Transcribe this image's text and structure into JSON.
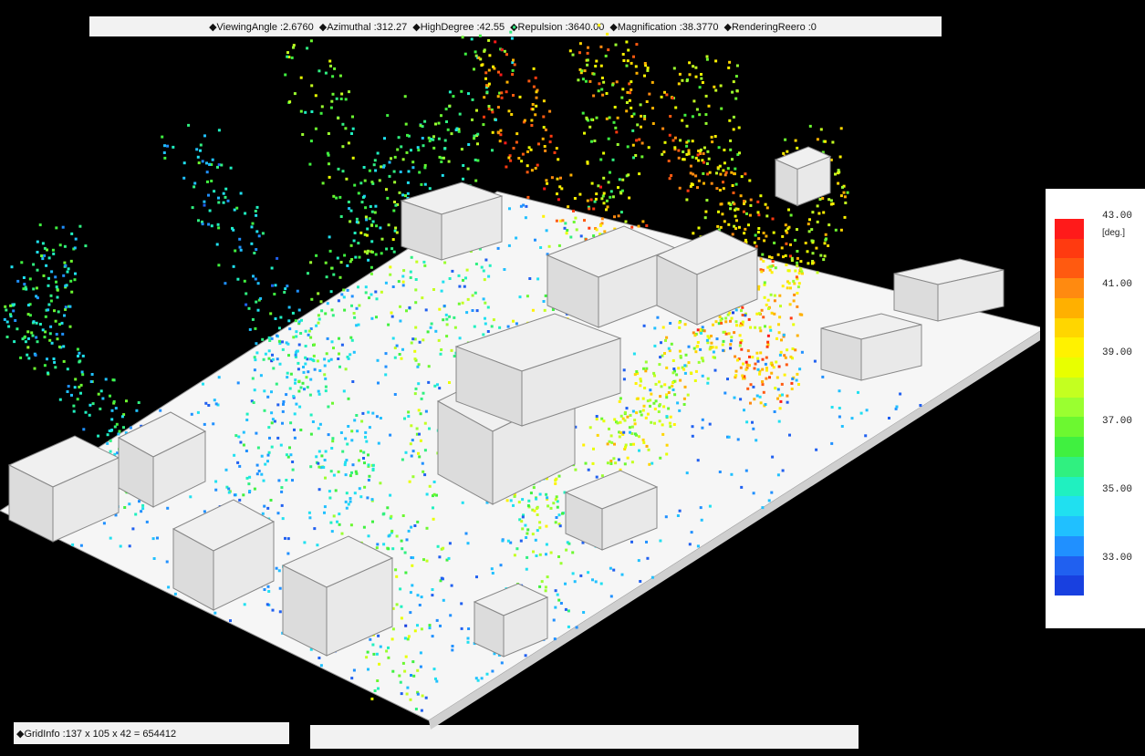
{
  "header": {
    "params": [
      {
        "label": "◆ViewingAngle",
        "value": "2.6760"
      },
      {
        "label": "◆Azimuthal",
        "value": "312.27"
      },
      {
        "label": "◆HighDegree",
        "value": "42.55"
      },
      {
        "label": "◆Repulsion",
        "value": "3640.00"
      },
      {
        "label": "◆Magnification",
        "value": "38.3770"
      },
      {
        "label": "◆RenderingReero",
        "value": "0"
      }
    ]
  },
  "footer": {
    "grid_info": "◆GridInfo :137 x 105 x 42 = 654412",
    "status_text": ""
  },
  "legend": {
    "unit": "[deg.]",
    "ticks": [
      "43.00",
      "41.00",
      "39.00",
      "37.00",
      "35.00",
      "33.00"
    ],
    "colors": [
      "#ff1a1a",
      "#ff3a10",
      "#ff5a10",
      "#ff8a10",
      "#ffb000",
      "#ffd600",
      "#fff200",
      "#e8ff00",
      "#c4ff20",
      "#9aff30",
      "#6cf830",
      "#40f040",
      "#30f080",
      "#20f0c0",
      "#20e0f0",
      "#20c0ff",
      "#2090ff",
      "#2060f0",
      "#1840e0"
    ],
    "range": [
      33,
      43
    ]
  },
  "scene": {
    "ground_color": "#f6f6f6",
    "building_color": "#e6e6e6"
  }
}
